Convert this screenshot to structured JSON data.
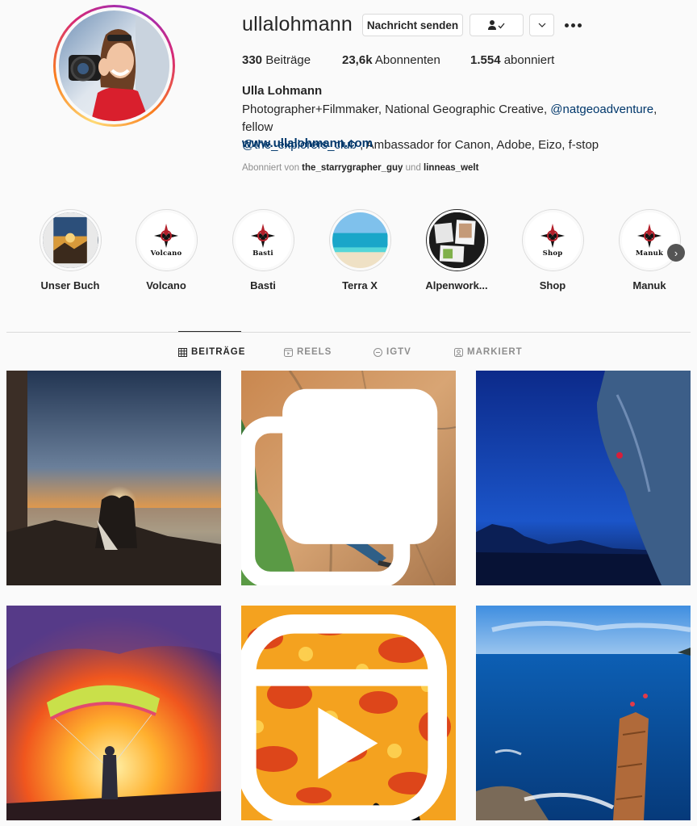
{
  "profile": {
    "username": "ullalohmann",
    "full_name": "Ulla Lohmann",
    "buttons": {
      "message": "Nachricht senden"
    },
    "stats": {
      "posts_count": "330",
      "posts_label": "Beiträge",
      "followers_count": "23,6k",
      "followers_label": "Abonnenten",
      "following_count": "1.554",
      "following_label": "abonniert"
    },
    "bio": {
      "line1_text": "Photographer+Filmmaker, National Geographic Creative, ",
      "mention1": "@natgeoadventure",
      "line1_tail": ", fellow",
      "mention2": "@the_explorers_club",
      "line2_text": " , Ambassador for Canon, Adobe, Eizo, f-stop"
    },
    "website": "www.ullalohmann.com",
    "followed_by": {
      "prefix": "Abonniert von",
      "user1": "the_starrygrapher_guy",
      "joiner": "und",
      "user2": "linneas_welt"
    }
  },
  "highlights": [
    {
      "label": "Unser Buch"
    },
    {
      "label": "Volcano",
      "logo_text": "Volcano"
    },
    {
      "label": "Basti",
      "logo_text": "Basti"
    },
    {
      "label": "Terra X"
    },
    {
      "label": "Alpenwork..."
    },
    {
      "label": "Shop",
      "logo_text": "Shop"
    },
    {
      "label": "Manuk",
      "logo_text": "Manuk"
    }
  ],
  "tabs": [
    {
      "label": "BEITRÄGE",
      "active": true
    },
    {
      "label": "REELS",
      "active": false
    },
    {
      "label": "IGTV",
      "active": false
    },
    {
      "label": "MARKIERT",
      "active": false
    }
  ],
  "posts": [
    {
      "scene": "couple-sunset-silhouette",
      "badge": ""
    },
    {
      "scene": "rock-climber-orange-wall",
      "badge": "carousel-icon"
    },
    {
      "scene": "climber-night-cliff",
      "badge": ""
    },
    {
      "scene": "paraglider-volcano-eruption",
      "badge": ""
    },
    {
      "scene": "lava-texture-silhouettes",
      "badge": "reel-icon"
    },
    {
      "scene": "sea-stack-blue-ocean",
      "badge": ""
    }
  ],
  "colors": {
    "link": "#00376b",
    "text": "#262626",
    "muted": "#8e8e8e",
    "border": "#dbdbdb"
  }
}
